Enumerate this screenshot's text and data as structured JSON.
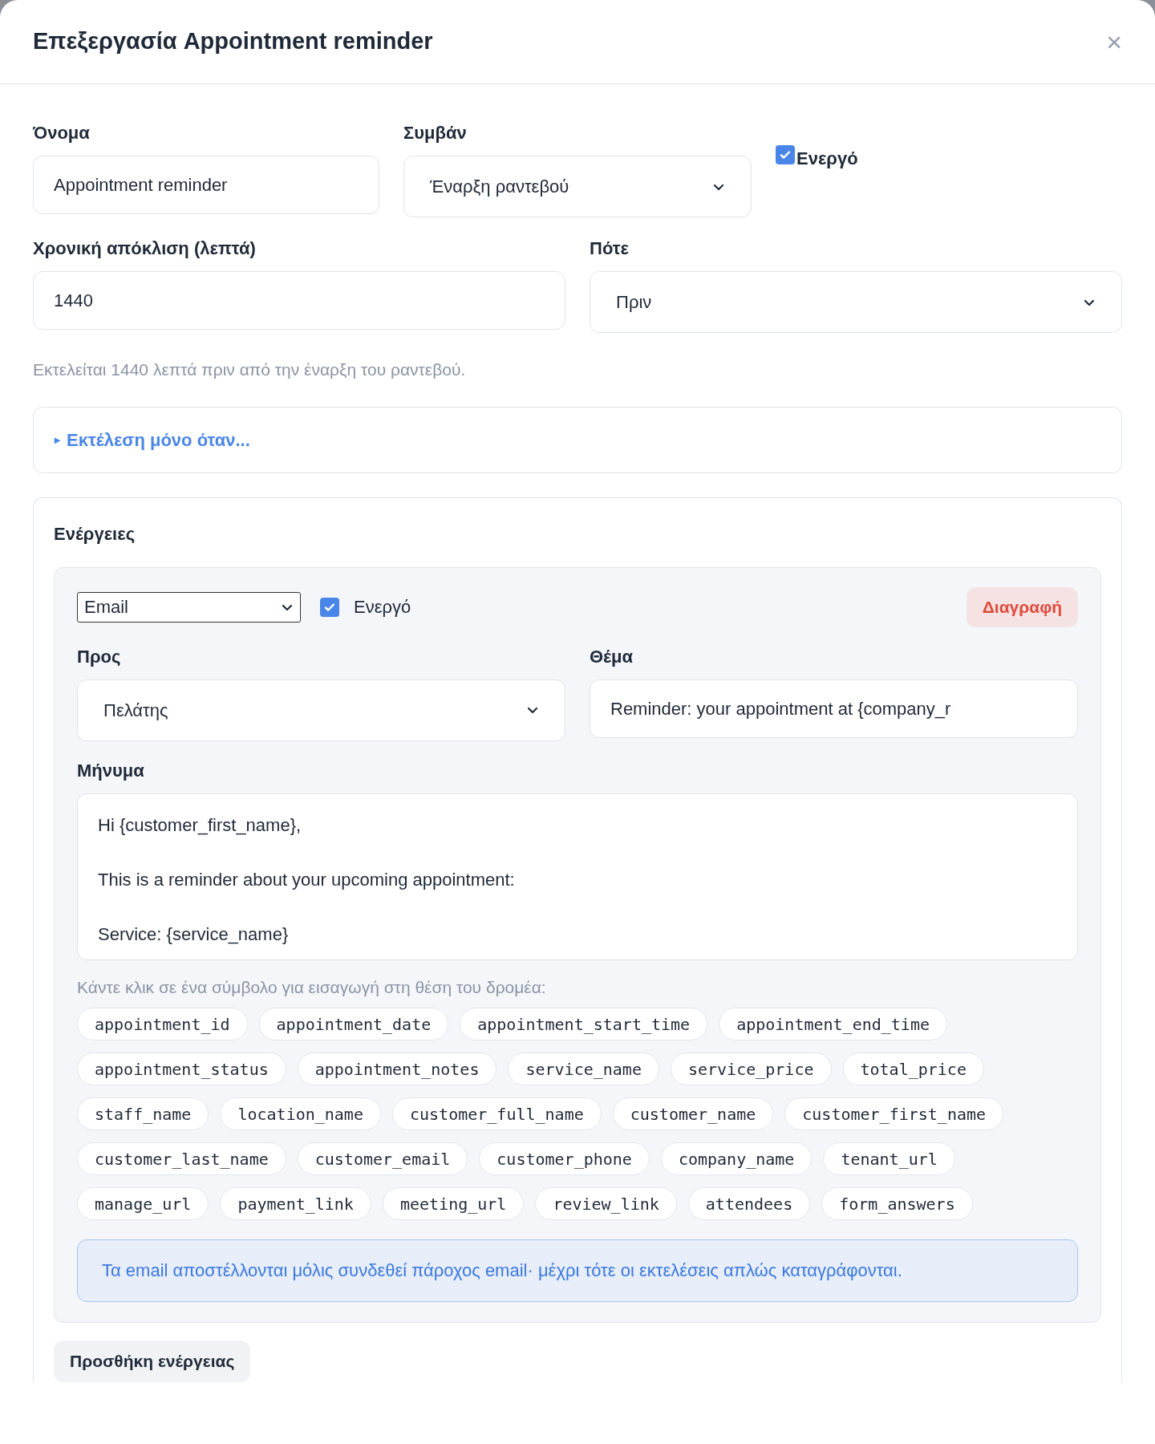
{
  "dialog": {
    "title": "Επεξεργασία Appointment reminder",
    "close": "×"
  },
  "form": {
    "name": {
      "label": "Όνομα",
      "value": "Appointment reminder"
    },
    "event": {
      "label": "Συμβάν",
      "value": "Έναρξη ραντεβού"
    },
    "active": {
      "label": "Ενεργό",
      "checked": true
    },
    "offset": {
      "label": "Χρονική απόκλιση (λεπτά)",
      "value": "1440"
    },
    "when": {
      "label": "Πότε",
      "value": "Πριν"
    },
    "hint": "Εκτελείται 1440 λεπτά πριν από την έναρξη του ραντεβού.",
    "condition": {
      "marker": "▸",
      "label": "Εκτέλεση μόνο όταν...",
      "expanded": false
    }
  },
  "actions": {
    "title": "Ενέργειες",
    "items": [
      {
        "type": "Email",
        "active": {
          "label": "Ενεργό",
          "checked": true
        },
        "delete": "Διαγραφή",
        "to": {
          "label": "Προς",
          "value": "Πελάτης"
        },
        "subject": {
          "label": "Θέμα",
          "value": "Reminder: your appointment at {company_r"
        },
        "message": {
          "label": "Μήνυμα",
          "value": "Hi {customer_first_name},\n\nThis is a reminder about your upcoming appointment:\n\nService: {service_name}"
        },
        "tokens_hint": "Κάντε κλικ σε ένα σύμβολο για εισαγωγή στη θέση του δρομέα:",
        "tokens": [
          "appointment_id",
          "appointment_date",
          "appointment_start_time",
          "appointment_end_time",
          "appointment_status",
          "appointment_notes",
          "service_name",
          "service_price",
          "total_price",
          "staff_name",
          "location_name",
          "customer_full_name",
          "customer_name",
          "customer_first_name",
          "customer_last_name",
          "customer_email",
          "customer_phone",
          "company_name",
          "tenant_url",
          "manage_url",
          "payment_link",
          "meeting_url",
          "review_link",
          "attendees",
          "form_answers"
        ],
        "notice": "Τα email αποστέλλονται μόλις συνδεθεί πάροχος email· μέχρι τότε οι εκτελέσεις απλώς καταγράφονται."
      }
    ],
    "add": "Προσθήκη ενέργειας"
  }
}
